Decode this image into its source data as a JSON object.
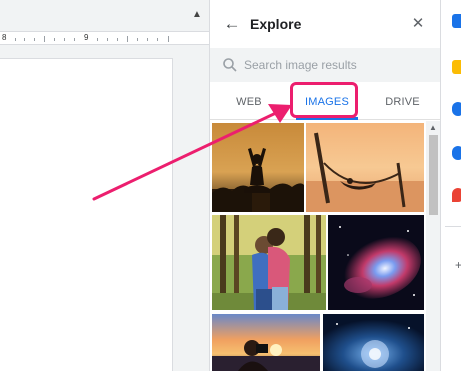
{
  "ruler": {
    "mark_8": "8",
    "mark_9": "9"
  },
  "explore": {
    "title": "Explore",
    "search_placeholder": "Search image results",
    "tabs": [
      {
        "label": "WEB",
        "active": false
      },
      {
        "label": "IMAGES",
        "active": true
      },
      {
        "label": "DRIVE",
        "active": false
      }
    ]
  },
  "image_results": [
    {
      "icon": "yoga-silhouette-image"
    },
    {
      "icon": "hammock-sunset-image"
    },
    {
      "icon": "couple-forest-image"
    },
    {
      "icon": "nebula-galaxy-image"
    },
    {
      "icon": "photographer-sunset-image"
    },
    {
      "icon": "blue-space-image"
    }
  ],
  "colors": {
    "accent": "#1a73e8",
    "annotation": "#ec1e6e",
    "rail_blue": "#1a73e8",
    "rail_yellow": "#fbbc04",
    "rail_red": "#ea4335",
    "rail_green": "#34a853"
  },
  "rail": [
    {
      "icon": "calendar-icon"
    },
    {
      "icon": "keep-icon"
    },
    {
      "icon": "tasks-icon"
    },
    {
      "icon": "contacts-icon"
    },
    {
      "icon": "maps-icon"
    },
    {
      "icon": "add-addon-icon"
    }
  ]
}
